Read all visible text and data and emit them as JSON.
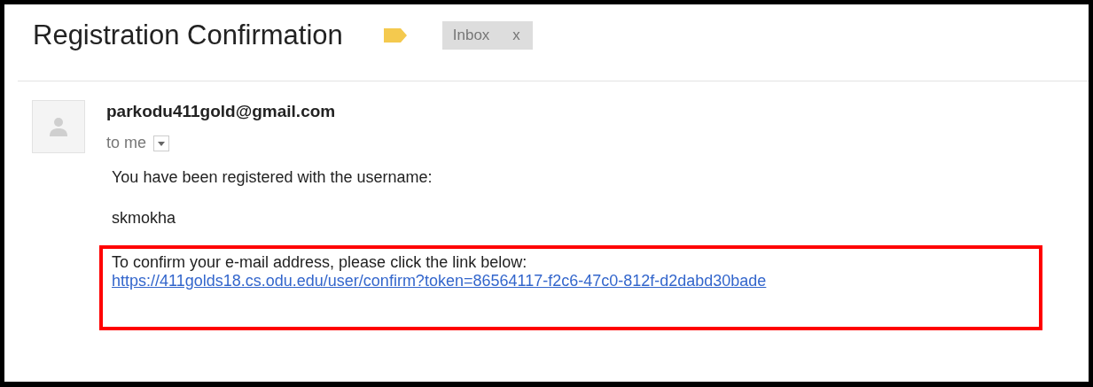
{
  "email": {
    "subject": "Registration Confirmation",
    "label": {
      "text": "Inbox",
      "remove": "x"
    },
    "sender": "parkodu411gold@gmail.com",
    "recipient": "to me",
    "body": [
      "You have been registered with the username:",
      "skmokha"
    ],
    "highlight": {
      "text": "To confirm your e-mail address, please click the link below:",
      "link": "https://411golds18.cs.odu.edu/user/confirm?token=86564117-f2c6-47c0-812f-d2dabd30bade"
    }
  }
}
